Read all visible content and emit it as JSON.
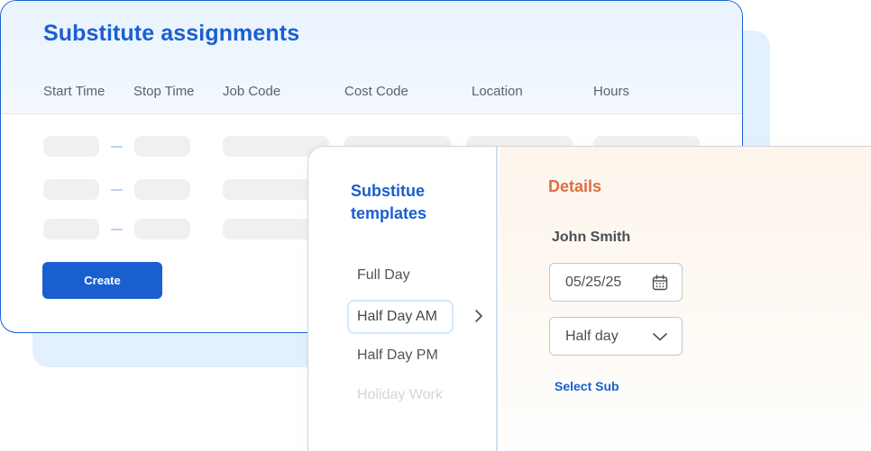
{
  "assignments": {
    "title": "Substitute assignments",
    "columns": [
      "Start Time",
      "Stop Time",
      "Job Code",
      "Cost Code",
      "Location",
      "Hours"
    ],
    "create_label": "Create"
  },
  "templates": {
    "title": "Substitue templates",
    "items": [
      "Full Day",
      "Half Day AM",
      "Half Day PM",
      "Holiday Work"
    ],
    "selected_index": 1
  },
  "details": {
    "title": "Details",
    "name": "John Smith",
    "date_value": "05/25/25",
    "duration_value": "Half day",
    "select_sub_label": "Select Sub"
  },
  "colors": {
    "primary": "#1a5fd0",
    "accent": "#dc6f43"
  },
  "icons": {
    "date": "calendar-icon",
    "duration": "chevron-down-icon",
    "template_arrow": "chevron-right-icon"
  }
}
